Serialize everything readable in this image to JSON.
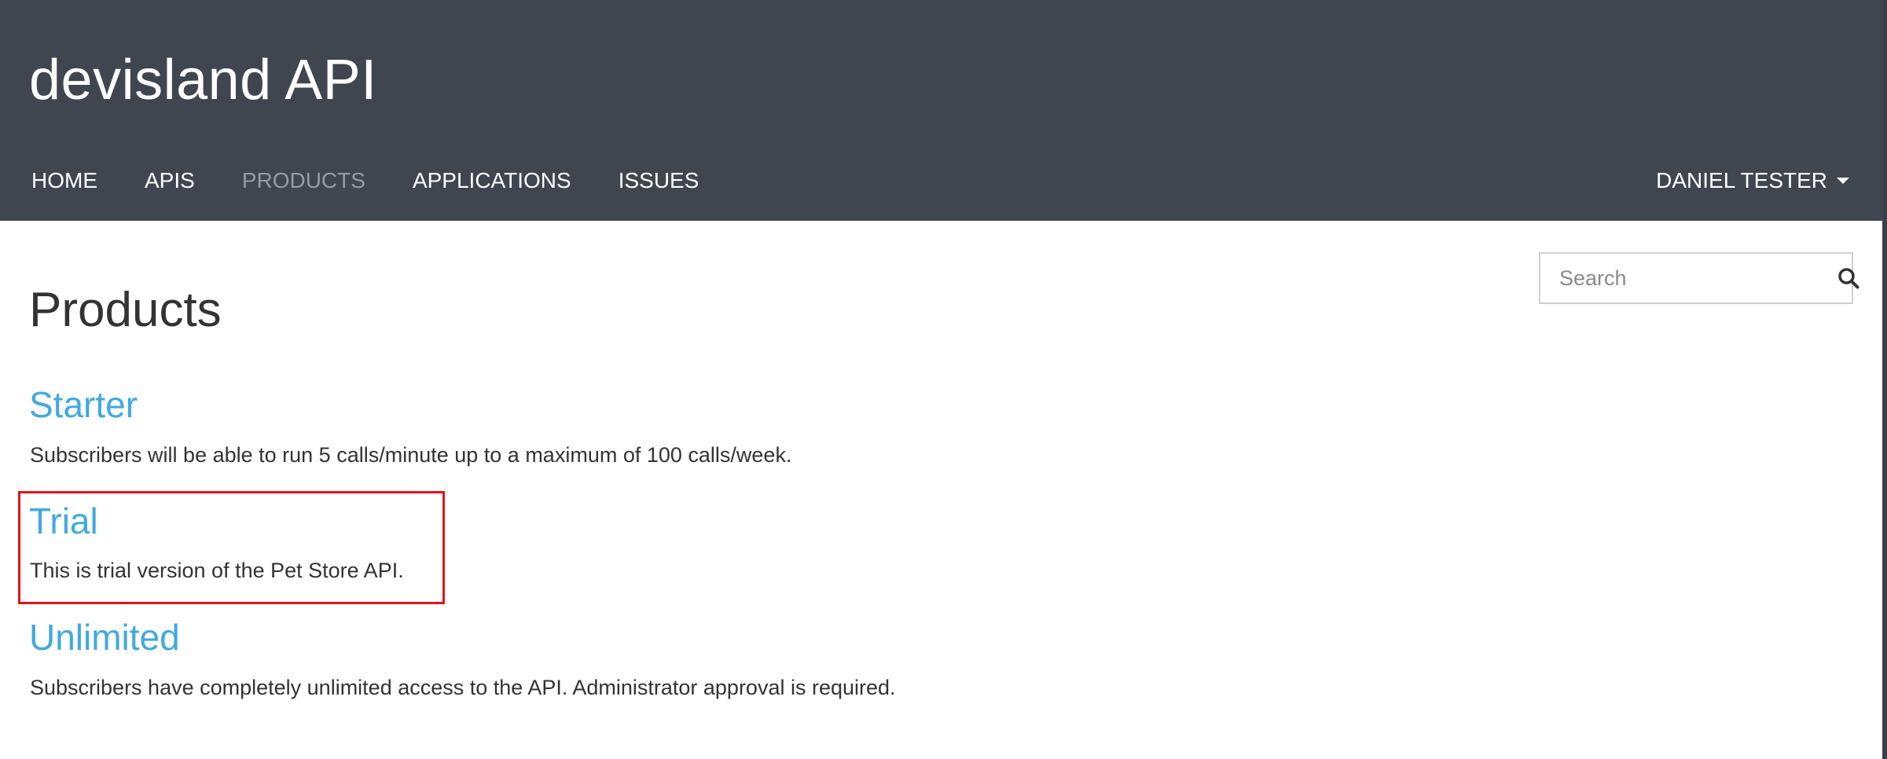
{
  "header": {
    "site_title": "devisland API",
    "nav": [
      {
        "label": "HOME",
        "active": false
      },
      {
        "label": "APIS",
        "active": false
      },
      {
        "label": "PRODUCTS",
        "active": true
      },
      {
        "label": "APPLICATIONS",
        "active": false
      },
      {
        "label": "ISSUES",
        "active": false
      }
    ],
    "user_name": "DANIEL TESTER",
    "colors": {
      "background": "#40464f",
      "active_nav": "#979ba1"
    }
  },
  "search": {
    "placeholder": "Search",
    "value": "",
    "icon": "search-icon"
  },
  "main": {
    "page_title": "Products",
    "products": [
      {
        "name": "Starter",
        "description": "Subscribers will be able to run 5 calls/minute up to a maximum of 100 calls/week."
      },
      {
        "name": "Trial",
        "description": "This is trial version of the Pet Store API.",
        "highlighted": true
      },
      {
        "name": "Unlimited",
        "description": "Subscribers have completely unlimited access to the API. Administrator approval is required."
      }
    ],
    "colors": {
      "link": "#41a9e0",
      "highlight": "#e3141b"
    }
  }
}
